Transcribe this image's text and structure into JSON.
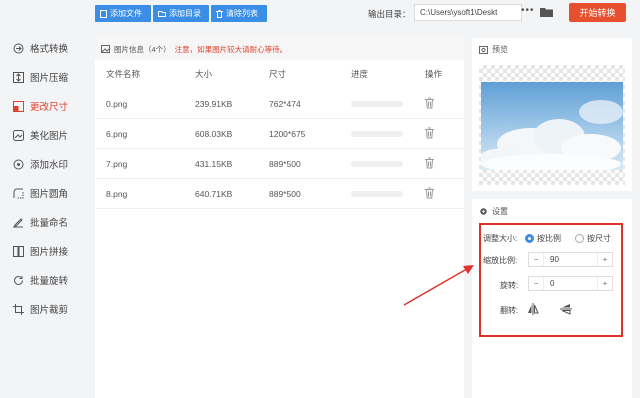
{
  "toolbar": {
    "add_file": "添加文件",
    "add_folder": "添加目录",
    "clear_list": "清除列表",
    "output_label": "输出目录：",
    "output_path": "C:\\Users\\ysoft1\\Deskt",
    "more": "•••",
    "convert": "开始转换"
  },
  "sidebar": {
    "items": [
      {
        "label": "格式转换",
        "icon": "format-convert-icon"
      },
      {
        "label": "图片压缩",
        "icon": "compress-icon"
      },
      {
        "label": "更改尺寸",
        "icon": "resize-icon"
      },
      {
        "label": "美化图片",
        "icon": "beautify-icon"
      },
      {
        "label": "添加水印",
        "icon": "watermark-icon"
      },
      {
        "label": "图片圆角",
        "icon": "round-corner-icon"
      },
      {
        "label": "批量命名",
        "icon": "rename-icon"
      },
      {
        "label": "图片拼接",
        "icon": "stitch-icon"
      },
      {
        "label": "批量旋转",
        "icon": "rotate-icon"
      },
      {
        "label": "图片裁剪",
        "icon": "crop-icon"
      }
    ],
    "active_index": 2,
    "active_color": "#e1402c"
  },
  "main": {
    "info_title": "图片信息（4个）",
    "info_warning": "注意，如果图片较大请耐心等待。",
    "columns": [
      "文件名称",
      "大小",
      "尺寸",
      "进度",
      "操作"
    ],
    "rows": [
      {
        "name": "0.png",
        "size": "239.91KB",
        "dim": "762*474"
      },
      {
        "name": "6.png",
        "size": "608.03KB",
        "dim": "1200*675"
      },
      {
        "name": "7.png",
        "size": "431.15KB",
        "dim": "889*500"
      },
      {
        "name": "8.png",
        "size": "640.71KB",
        "dim": "889*500"
      }
    ]
  },
  "preview": {
    "title": "预览"
  },
  "settings": {
    "title": "设置",
    "resize_label": "调整大小:",
    "opt_ratio": "按比例",
    "opt_size": "按尺寸",
    "scale_label": "缩放比例:",
    "scale_value": "90",
    "rotate_label": "旋转:",
    "rotate_value": "0",
    "flip_label": "翻转:",
    "minus": "−",
    "plus": "+"
  },
  "colors": {
    "accent": "#3a8ee6",
    "convert": "#e7502f",
    "highlight": "#e0312a"
  }
}
